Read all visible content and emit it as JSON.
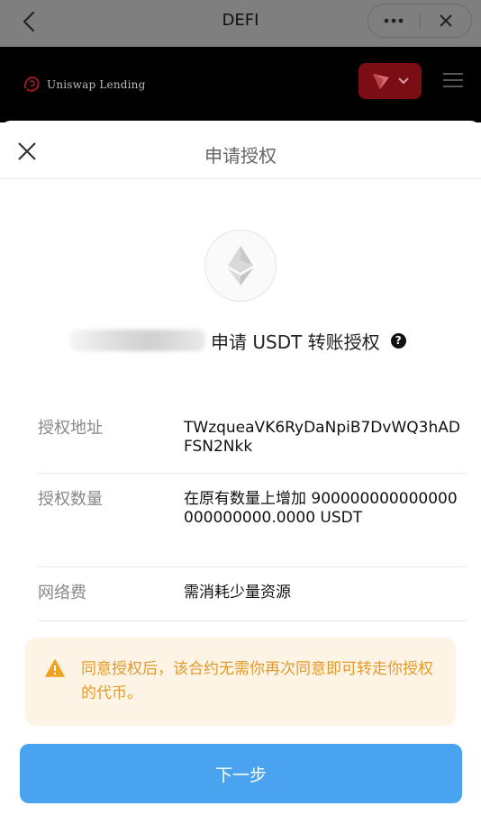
{
  "topbar": {
    "title": "DEFI"
  },
  "dapp": {
    "brand": "Uniswap Lending"
  },
  "modal": {
    "title": "申请授权",
    "request_text": "申请 USDT 转账授权",
    "help_glyph": "?",
    "rows": [
      {
        "label": "授权地址",
        "value": "TWzqueaVK6RyDaNpiB7DvWQ3hADFSN2Nkk"
      },
      {
        "label": "授权数量",
        "value": "在原有数量上增加 900000000000000000000000.0000 USDT"
      },
      {
        "label": "网络费",
        "value": "需消耗少量资源"
      }
    ],
    "warning": "同意授权后，该合约无需你再次同意即可转走你授权的代币。",
    "next_label": "下一步"
  },
  "colors": {
    "accent_button": "#4aa3ee",
    "warning_text": "#e39a2a",
    "warning_bg": "#fdf4e6",
    "wallet_button": "#7a0e14"
  },
  "icons": [
    "back-chevron-icon",
    "more-dots-icon",
    "close-icon",
    "uniswap-logo-icon",
    "tron-logo-icon",
    "chevron-down-icon",
    "hamburger-menu-icon",
    "ethereum-icon",
    "help-icon",
    "warning-triangle-icon"
  ]
}
